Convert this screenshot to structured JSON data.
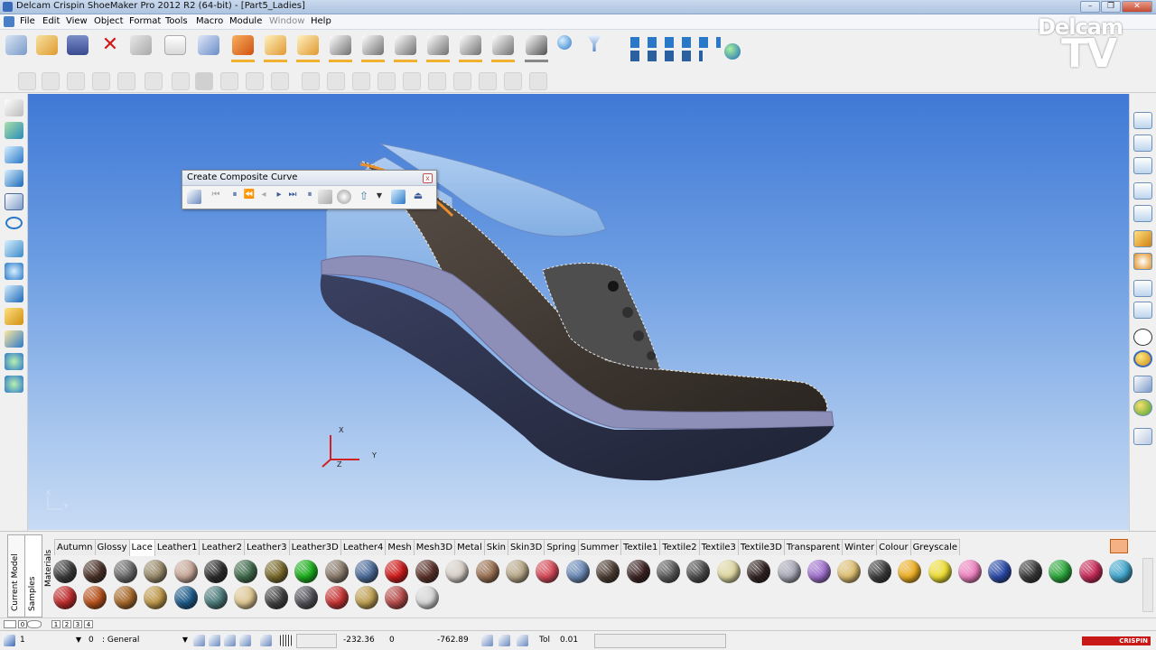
{
  "window": {
    "title": "Delcam Crispin ShoeMaker Pro 2012 R2 (64-bit) - [Part5_Ladies]",
    "minimize": "–",
    "restore": "❐",
    "close": "✕"
  },
  "menu": [
    "File",
    "Edit",
    "View",
    "Object",
    "Format",
    "Tools",
    "Macro",
    "Module",
    "Window",
    "Help"
  ],
  "palette": {
    "title": "Create Composite Curve",
    "close": "x"
  },
  "brand": {
    "line1": "Delcam",
    "line2": "TV"
  },
  "axes": {
    "x": "X",
    "y": "Y",
    "z": "Z"
  },
  "materials": {
    "vertical_tabs": [
      "Current Model",
      "Samples",
      "Materials"
    ],
    "tabs": [
      "Autumn",
      "Glossy",
      "Lace",
      "Leather1",
      "Leather2",
      "Leather3",
      "Leather3D",
      "Leather4",
      "Mesh",
      "Mesh3D",
      "Metal",
      "Skin",
      "Skin3D",
      "Spring",
      "Summer",
      "Textile1",
      "Textile2",
      "Textile3",
      "Textile3D",
      "Transparent",
      "Winter",
      "Colour",
      "Greyscale"
    ],
    "active_tab": "Lace",
    "row1_colors": [
      "#3a3a3a",
      "#4a3026",
      "#6a6a6a",
      "#9a8a6a",
      "#c8a898",
      "#2a2a2a",
      "#3e6a4a",
      "#7a6a2a",
      "#18b018",
      "#8a7a6a",
      "#4a6a9a",
      "#d01818",
      "#5a3028",
      "#d8d0c8",
      "#9a7050",
      "#b8a888",
      "#d84858",
      "#6a8ab8",
      "#4a3a30",
      "#3a2020",
      "#5a5a5a",
      "#4a4a4a",
      "#e0d8a0",
      "#302020",
      "#a8a8b8",
      "#a070d0",
      "#e0c070",
      "#3a3a3a",
      "#f0b020",
      "#f0e030",
      "#f080c0",
      "#2848a8",
      "#383838",
      "#28a838",
      "#c82858",
      "#40a8d0"
    ],
    "row2_colors": [
      "#c02828",
      "#b85018",
      "#a86828",
      "#c09848",
      "#1a5a8a",
      "#4a7a7a",
      "#e0c890",
      "#404040",
      "#505058",
      "#c83030",
      "#c0a050",
      "#b84848",
      "#d8d8d8"
    ]
  },
  "layers": [
    "0",
    "1",
    "2",
    "3",
    "4"
  ],
  "status": {
    "layer_value": "1",
    "level_number": "0",
    "level_name": ": General",
    "coord_x": "-232.36",
    "coord_y": "0",
    "coord_z": "-762.89",
    "tol_label": "Tol",
    "tol_value": "0.01",
    "brand": "CRISPIN"
  }
}
